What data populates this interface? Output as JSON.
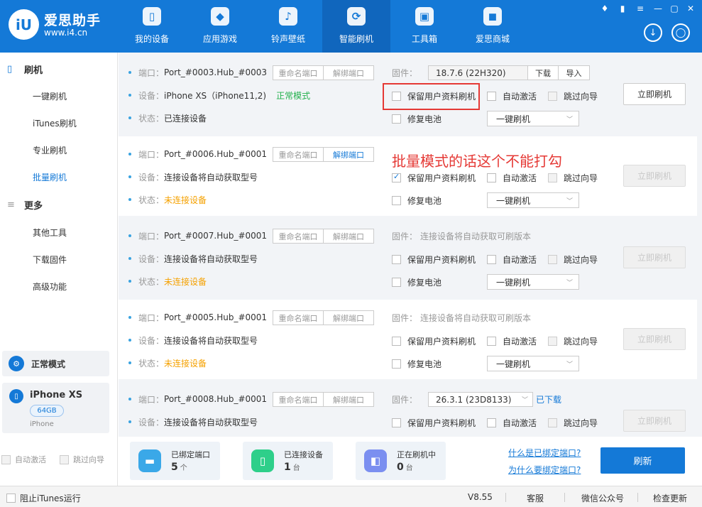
{
  "app": {
    "name": "爱思助手",
    "url": "www.i4.cn",
    "logo_text": "iU"
  },
  "nav": [
    {
      "label": "我的设备",
      "icon": "phone-icon",
      "glyph": "▯"
    },
    {
      "label": "应用游戏",
      "icon": "cube-icon",
      "glyph": "◆"
    },
    {
      "label": "铃声壁纸",
      "icon": "music-icon",
      "glyph": "♪"
    },
    {
      "label": "智能刷机",
      "icon": "refresh-icon",
      "glyph": "⟳"
    },
    {
      "label": "工具箱",
      "icon": "toolbox-icon",
      "glyph": "▣"
    },
    {
      "label": "爱思商城",
      "icon": "bag-icon",
      "glyph": "◼"
    }
  ],
  "header_icons": {
    "download": "↓",
    "user": "◯"
  },
  "sidebar": {
    "flash_title": "刷机",
    "flash_items": [
      "一键刷机",
      "iTunes刷机",
      "专业刷机",
      "批量刷机"
    ],
    "more_title": "更多",
    "more_items": [
      "其他工具",
      "下载固件",
      "高级功能"
    ],
    "mode": "正常模式",
    "device": {
      "name": "iPhone XS",
      "capacity": "64GB",
      "type": "iPhone"
    },
    "opt_auto_activate": "自动激活",
    "opt_skip_guide": "跳过向导"
  },
  "labels": {
    "port": "端口：",
    "device": "设备：",
    "status": "状态：",
    "firmware": "固件：",
    "rename": "重命名端口",
    "unbind": "解绑端口",
    "download": "下载",
    "import": "导入",
    "keep_data": "保留用户资料刷机",
    "auto_activate": "自动激活",
    "skip_guide": "跳过向导",
    "repair_battery": "修复电池",
    "flash_mode": "一键刷机",
    "flash_now": "立即刷机"
  },
  "ports": [
    {
      "port": "Port_#0003.Hub_#0003",
      "device": "iPhone XS（iPhone11,2)",
      "mode": "正常模式",
      "status": "已连接设备",
      "firmware": "18.7.6 (22H320)"
    },
    {
      "port": "Port_#0006.Hub_#0001",
      "device": "连接设备将自动获取型号",
      "status": "未连接设备"
    },
    {
      "port": "Port_#0007.Hub_#0001",
      "device": "连接设备将自动获取型号",
      "status": "未连接设备",
      "firmware_text": "连接设备将自动获取可刷版本"
    },
    {
      "port": "Port_#0005.Hub_#0001",
      "device": "连接设备将自动获取型号",
      "status": "未连接设备",
      "firmware_text": "连接设备将自动获取可刷版本"
    },
    {
      "port": "Port_#0008.Hub_#0001",
      "device": "连接设备将自动获取型号",
      "firmware": "26.3.1 (23D8133)",
      "firmware_status": "已下载"
    }
  ],
  "annotation": "批量模式的话这个不能打勾",
  "stats": [
    {
      "label": "已绑定端口",
      "value": "5",
      "unit": "个",
      "color": "#3aa8e8"
    },
    {
      "label": "已连接设备",
      "value": "1",
      "unit": "台",
      "color": "#2ecf8a"
    },
    {
      "label": "正在刷机中",
      "value": "0",
      "unit": "台",
      "color": "#7b8ff0"
    }
  ],
  "links": {
    "what_bound": "什么是已绑定端口?",
    "why_bind": "为什么要绑定端口?"
  },
  "refresh": "刷新",
  "footer": {
    "block_itunes": "阻止iTunes运行",
    "version": "V8.55",
    "service": "客服",
    "wechat": "微信公众号",
    "update": "检查更新"
  }
}
